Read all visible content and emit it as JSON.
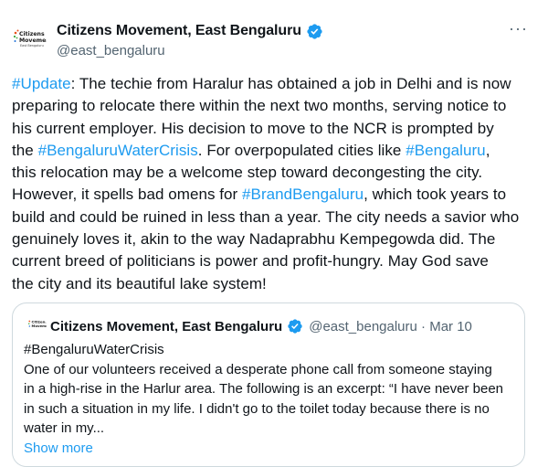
{
  "tweet": {
    "author_name": "Citizens Movement, East Bengaluru",
    "author_handle": "@east_bengaluru",
    "avatar_text": [
      "Citizens",
      "Movement",
      "East Bengaluru"
    ],
    "more_label": "···",
    "body_lines": [
      [
        {
          "t": "#Update",
          "h": true
        },
        {
          "t": ": The techie from Haralur has obtained a job in Delhi and is now"
        }
      ],
      [
        {
          "t": "preparing to relocate there within the next two months, serving notice to"
        }
      ],
      [
        {
          "t": "his current employer. His decision to move to the NCR is prompted by"
        }
      ],
      [
        {
          "t": "the "
        },
        {
          "t": "#BengaluruWaterCrisis",
          "h": true
        },
        {
          "t": ". For overpopulated cities like "
        },
        {
          "t": "#Bengaluru",
          "h": true
        },
        {
          "t": ","
        }
      ],
      [
        {
          "t": "this relocation may be a welcome step toward decongesting the city."
        }
      ],
      [
        {
          "t": "However, it spells bad omens for "
        },
        {
          "t": "#BrandBengaluru",
          "h": true
        },
        {
          "t": ", which took years to"
        }
      ],
      [
        {
          "t": "build and could be ruined in less than a year. The city needs a savior who"
        }
      ],
      [
        {
          "t": "genuinely loves it, akin to the way Nadaprabhu Kempegowda did. The"
        }
      ],
      [
        {
          "t": "current breed of politicians is power and profit-hungry. May God save"
        }
      ],
      [
        {
          "t": "the city and its beautiful lake system!"
        }
      ]
    ]
  },
  "quote": {
    "author_name": "Citizens Movement, East Bengaluru",
    "meta": "@east_bengaluru · Mar 10",
    "body_lines": [
      "#BengaluruWaterCrisis",
      "One of our volunteers received a desperate phone call from someone staying",
      "in a high-rise in the Harlur area. The following is an excerpt: “I have never been",
      "in such a situation in my life. I didn't go to the toilet today because there is no",
      "water in my..."
    ],
    "show_more": "Show more"
  },
  "colors": {
    "link": "#1d9bf0",
    "text": "#0f1419",
    "muted": "#536471",
    "border": "#cfd9de",
    "verified": "#1d9bf0"
  },
  "icons": {
    "verified": "verified-badge-icon",
    "more": "more-options-icon"
  }
}
